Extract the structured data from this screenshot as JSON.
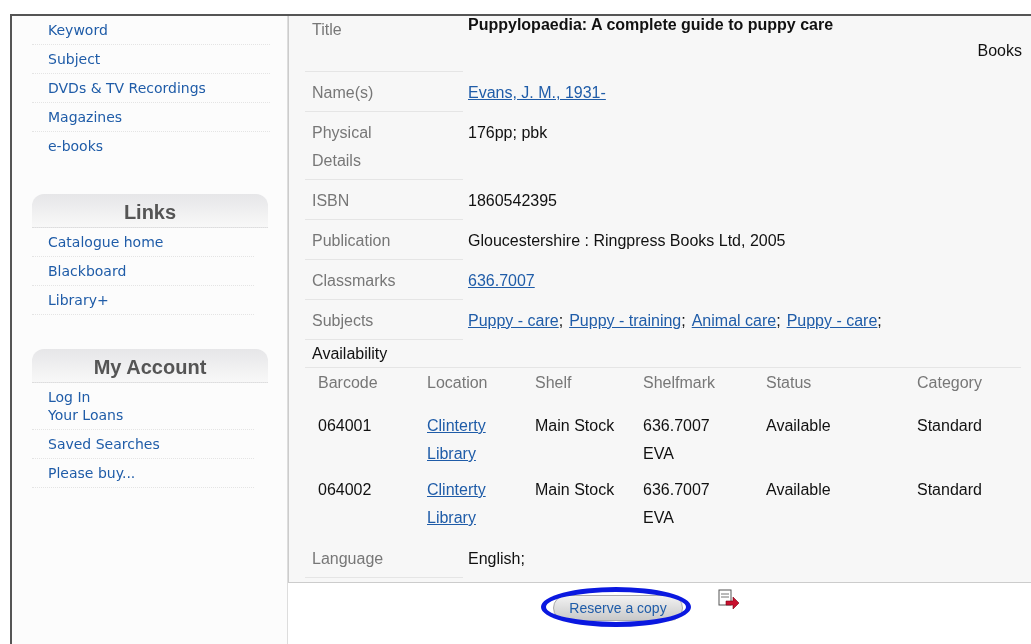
{
  "sidebar": {
    "search_links": [
      "Keyword",
      "Subject",
      "DVDs & TV Recordings",
      "Magazines",
      "e-books"
    ],
    "sections": [
      {
        "heading": "Links",
        "items": [
          {
            "lines": [
              "Catalogue home"
            ]
          },
          {
            "lines": [
              "Blackboard"
            ]
          },
          {
            "lines": [
              "Library+"
            ]
          }
        ]
      },
      {
        "heading": "My Account",
        "items": [
          {
            "lines": [
              "Log In",
              "Your Loans"
            ]
          },
          {
            "lines": [
              "Saved Searches"
            ]
          },
          {
            "lines": [
              "Please buy..."
            ]
          }
        ]
      }
    ]
  },
  "record": {
    "fields": [
      {
        "kind": "title",
        "label": "Title",
        "value": "Puppylopaedia: A complete guide to puppy care",
        "format": "Books"
      },
      {
        "kind": "link",
        "label": "Name(s)",
        "value": "Evans, J. M., 1931-"
      },
      {
        "kind": "text",
        "label": "Physical Details",
        "value": "176pp; pbk"
      },
      {
        "kind": "text",
        "label": "ISBN",
        "value": "1860542395"
      },
      {
        "kind": "text",
        "label": "Publication",
        "value": "Gloucestershire : Ringpress Books Ltd, 2005"
      },
      {
        "kind": "link",
        "label": "Classmarks",
        "value": "636.7007"
      },
      {
        "kind": "links",
        "label": "Subjects",
        "values": [
          "Puppy - care",
          "Puppy - training",
          "Animal care",
          "Puppy - care"
        ],
        "separator": ";"
      },
      {
        "kind": "availability",
        "label": "Availability",
        "columns": [
          "Barcode",
          "Location",
          "Shelf",
          "Shelfmark",
          "Status",
          "Category"
        ],
        "rows": [
          [
            "064001",
            "Clinterty Library",
            "Main Stock",
            "636.7007 EVA",
            "Available",
            "Standard"
          ],
          [
            "064002",
            "Clinterty Library",
            "Main Stock",
            "636.7007 EVA",
            "Available",
            "Standard"
          ]
        ]
      },
      {
        "kind": "text",
        "label": "Language",
        "value": "English;"
      }
    ]
  },
  "reserve_button": {
    "label": "Reserve a copy",
    "highlighted": true
  }
}
